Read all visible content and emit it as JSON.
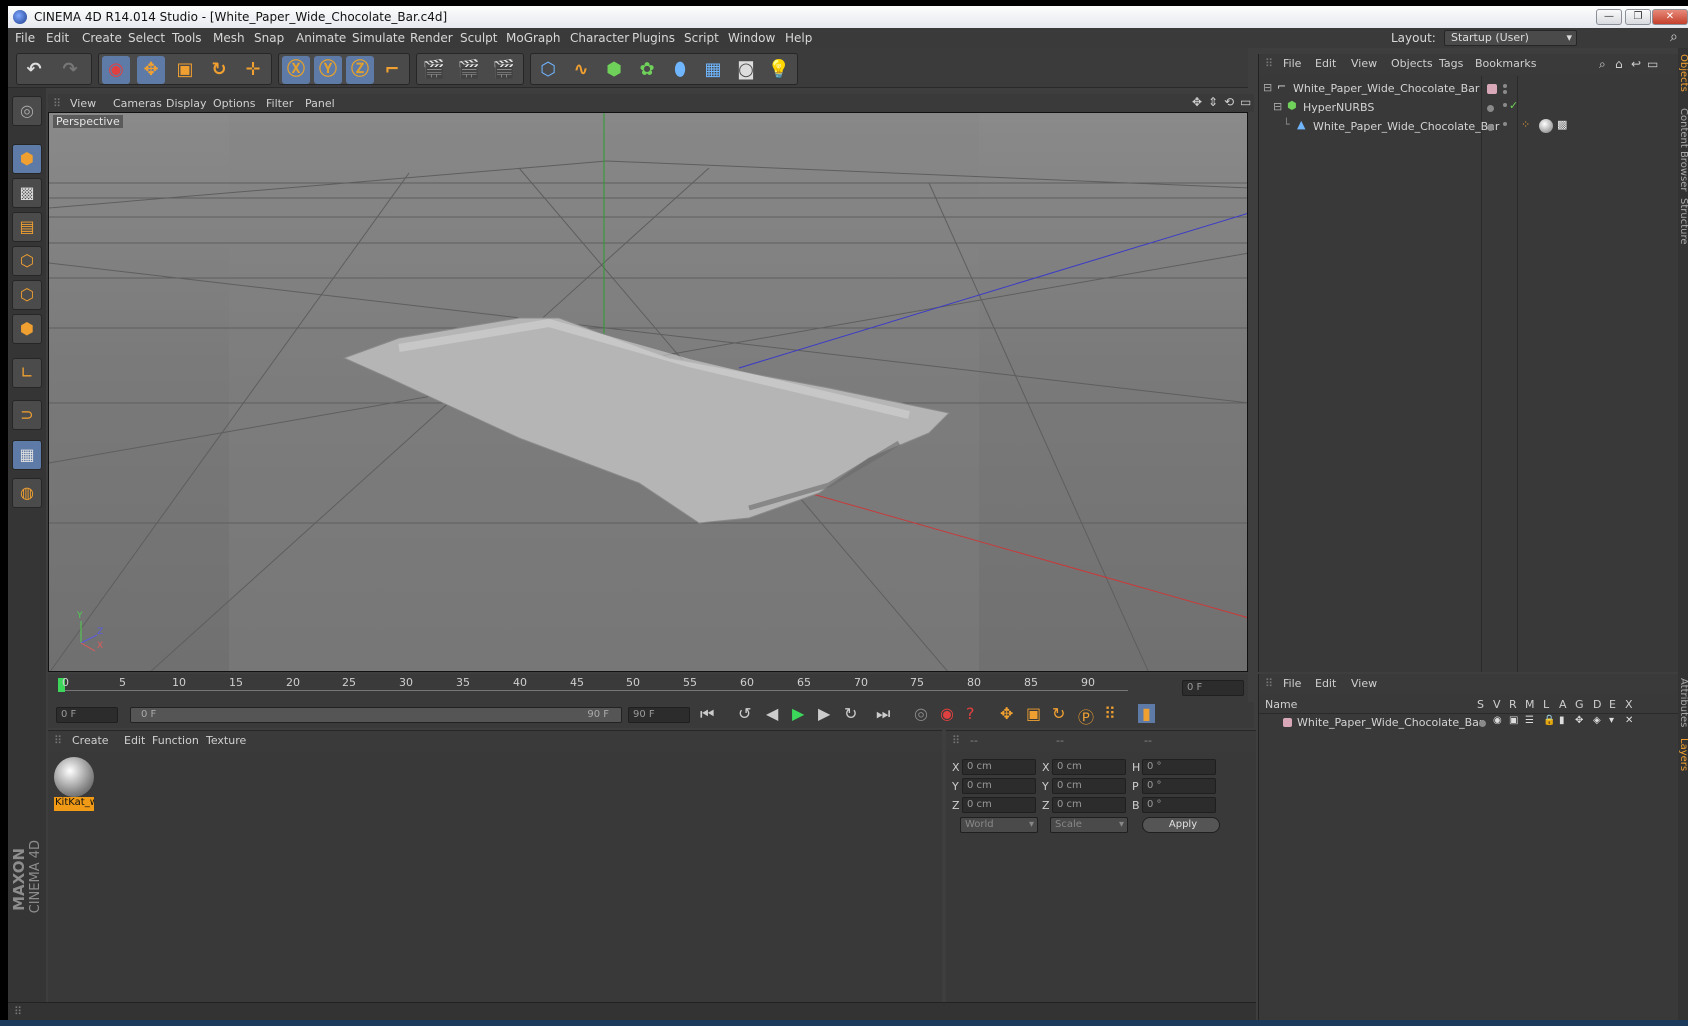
{
  "window": {
    "title": "CINEMA 4D R14.014 Studio - [White_Paper_Wide_Chocolate_Bar.c4d]",
    "min": "—",
    "max": "❐",
    "close": "✕"
  },
  "menu": {
    "items": [
      "File",
      "Edit",
      "Create",
      "Select",
      "Tools",
      "Mesh",
      "Snap",
      "Animate",
      "Simulate",
      "Render",
      "Sculpt",
      "MoGraph",
      "Character",
      "Plugins",
      "Script",
      "Window",
      "Help"
    ],
    "layout_label": "Layout:",
    "layout_value": "Startup (User)"
  },
  "viewport": {
    "menu": [
      "View",
      "Cameras",
      "Display",
      "Options",
      "Filter",
      "Panel"
    ],
    "label": "Perspective",
    "axis_y": "Y",
    "axis_z": "Z",
    "axis_x": "X"
  },
  "timeline": {
    "ticks": [
      "0",
      "5",
      "10",
      "15",
      "20",
      "25",
      "30",
      "35",
      "40",
      "45",
      "50",
      "55",
      "60",
      "65",
      "70",
      "75",
      "80",
      "85",
      "90"
    ],
    "frame_right": "0 F"
  },
  "transport": {
    "start": "0 F",
    "range_left": "0 F",
    "range_right": "90 F",
    "end": "90 F"
  },
  "materials": {
    "menu": [
      "Create",
      "Edit",
      "Function",
      "Texture"
    ],
    "items": [
      {
        "name": "KitKat_w"
      }
    ]
  },
  "coords": {
    "headers": [
      "--",
      "--",
      "--"
    ],
    "rows": [
      {
        "a": "X",
        "av": "0 cm",
        "b": "X",
        "bv": "0 cm",
        "c": "H",
        "cv": "0 °"
      },
      {
        "a": "Y",
        "av": "0 cm",
        "b": "Y",
        "bv": "0 cm",
        "c": "P",
        "cv": "0 °"
      },
      {
        "a": "Z",
        "av": "0 cm",
        "b": "Z",
        "bv": "0 cm",
        "c": "B",
        "cv": "0 °"
      }
    ],
    "mode": "World",
    "mode2": "Scale",
    "apply": "Apply"
  },
  "objects": {
    "menu": [
      "File",
      "Edit",
      "View",
      "Objects",
      "Tags",
      "Bookmarks"
    ],
    "items": [
      {
        "name": "White_Paper_Wide_Chocolate_Bar",
        "level": 0
      },
      {
        "name": "HyperNURBS",
        "level": 1
      },
      {
        "name": "White_Paper_Wide_Chocolate_Bar",
        "level": 2
      }
    ]
  },
  "layers": {
    "menu": [
      "File",
      "Edit",
      "View"
    ],
    "col_name": "Name",
    "cols": [
      "S",
      "V",
      "R",
      "M",
      "L",
      "A",
      "G",
      "D",
      "E",
      "X"
    ],
    "items": [
      {
        "name": "White_Paper_Wide_Chocolate_Bar"
      }
    ]
  },
  "sidetabs": [
    "Objects",
    "Content Browser",
    "Structure"
  ],
  "sidetabs2": [
    "Attributes",
    "Layers"
  ],
  "brand": {
    "maxon": "MAXON",
    "cinema": "CINEMA 4D"
  }
}
